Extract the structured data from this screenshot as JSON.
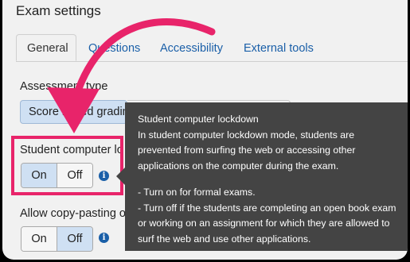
{
  "header": {
    "title": "Exam settings"
  },
  "tabs": [
    {
      "label": "General",
      "active": true
    },
    {
      "label": "Questions",
      "active": false
    },
    {
      "label": "Accessibility",
      "active": false
    },
    {
      "label": "External tools",
      "active": false
    }
  ],
  "assessment": {
    "label": "Assessment type",
    "selected": "Score based grading"
  },
  "lockdown": {
    "label": "Student computer lockdown",
    "on_label": "On",
    "off_label": "Off",
    "selected": "On"
  },
  "copy_paste": {
    "label": "Allow copy-pasting of",
    "on_label": "On",
    "off_label": "Off",
    "selected": "Off"
  },
  "tooltip": {
    "title": "Student computer lockdown",
    "description": "In student computer lockdown mode, students are prevented from surfing the web or accessing other applications on the computer during the exam.",
    "point1": "- Turn on for formal exams.",
    "point2": "- Turn off if the students are completing an open book exam or working on an assignment for which they are allowed to surf the web and use other applications."
  },
  "icons": {
    "info": "info-icon",
    "annotation_arrow": "curved-arrow-icon"
  },
  "colors": {
    "accent": "#1a5fa8",
    "highlight": "#e8246a",
    "selected": "#cfe0f3",
    "tooltip_bg": "#444444"
  }
}
